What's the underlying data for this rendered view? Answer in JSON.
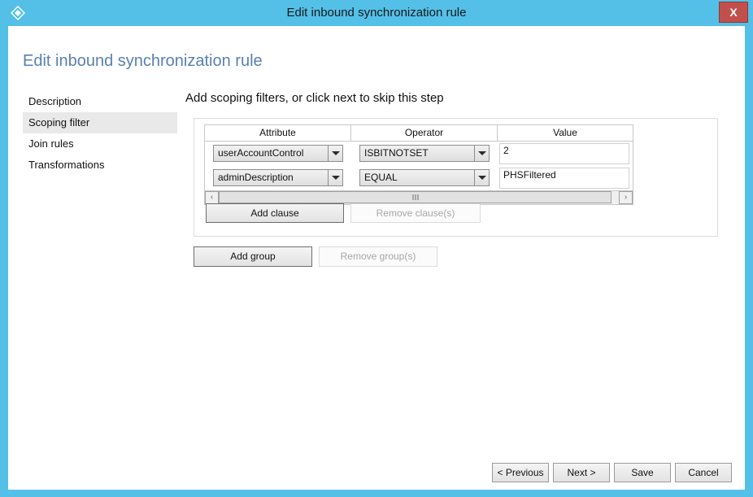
{
  "window": {
    "title": "Edit inbound synchronization rule",
    "icon": "azure-diamond-icon",
    "close_label": "X",
    "border_color": "#54c0e8",
    "titlebar_color": "#54c0e8",
    "close_color": "#c1504c"
  },
  "page": {
    "title": "Edit inbound synchronization rule",
    "title_color": "#5a80b0"
  },
  "sidebar": {
    "items": [
      {
        "label": "Description",
        "selected": false
      },
      {
        "label": "Scoping filter",
        "selected": true
      },
      {
        "label": "Join rules",
        "selected": false
      },
      {
        "label": "Transformations",
        "selected": false
      }
    ]
  },
  "main": {
    "heading": "Add scoping filters, or click next to skip this step",
    "table": {
      "columns": [
        "Attribute",
        "Operator",
        "Value"
      ],
      "rows": [
        {
          "attribute": "userAccountControl",
          "operator": "ISBITNOTSET",
          "value": "2"
        },
        {
          "attribute": "adminDescription",
          "operator": "EQUAL",
          "value": "PHSFiltered"
        }
      ]
    },
    "scrollbar": {
      "left_arrow": "‹",
      "right_arrow": "›"
    },
    "clause_buttons": {
      "add": "Add clause",
      "remove": "Remove clause(s)"
    },
    "group_buttons": {
      "add": "Add group",
      "remove": "Remove group(s)"
    }
  },
  "footer": {
    "previous": "< Previous",
    "next": "Next >",
    "save": "Save",
    "cancel": "Cancel"
  }
}
